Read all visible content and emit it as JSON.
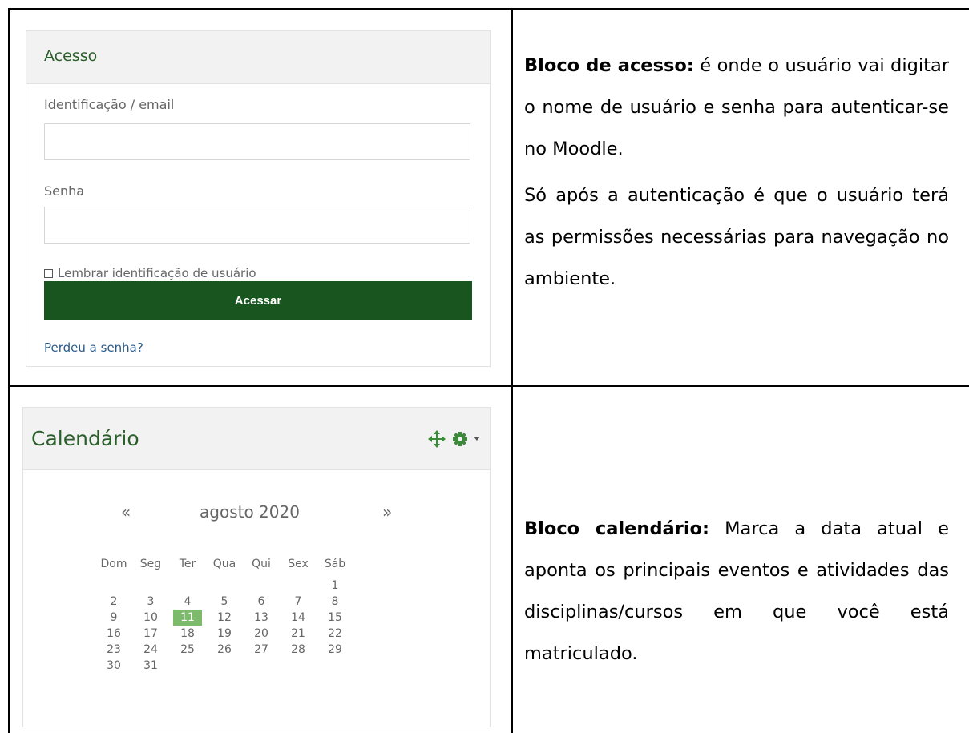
{
  "login": {
    "title": "Acesso",
    "username_label": "Identificação / email",
    "username_value": "",
    "password_label": "Senha",
    "password_value": "",
    "remember_label": "Lembrar identificação de usuário",
    "remember_checked": false,
    "submit_label": "Acessar",
    "forgot_link": "Perdeu a senha?"
  },
  "login_desc": {
    "bold": "Bloco de acesso:",
    "text1": " é onde o usuário vai digitar o nome de usuário e senha para autenticar-se no Moodle.",
    "text2": "Só após a autenticação é que o usuário terá as permissões necessárias para navegação no ambiente."
  },
  "calendar": {
    "title": "Calendário",
    "prev": "«",
    "next": "»",
    "month": "agosto 2020",
    "weekdays": [
      "Dom",
      "Seg",
      "Ter",
      "Qua",
      "Qui",
      "Sex",
      "Sáb"
    ],
    "weeks": [
      [
        "",
        "",
        "",
        "",
        "",
        "",
        "1"
      ],
      [
        "2",
        "3",
        "4",
        "5",
        "6",
        "7",
        "8"
      ],
      [
        "9",
        "10",
        "11",
        "12",
        "13",
        "14",
        "15"
      ],
      [
        "16",
        "17",
        "18",
        "19",
        "20",
        "21",
        "22"
      ],
      [
        "23",
        "24",
        "25",
        "26",
        "27",
        "28",
        "29"
      ],
      [
        "30",
        "31",
        "",
        "",
        "",
        "",
        ""
      ]
    ],
    "today": "11",
    "today_color": "#7cba6c",
    "icons": [
      "move-icon",
      "gear-icon",
      "caret-down-icon"
    ]
  },
  "calendar_desc": {
    "bold": "Bloco calendário:",
    "text1": " Marca a data atual e aponta os principais eventos e atividades das disciplinas/cursos em que você está matriculado."
  },
  "colors": {
    "accent": "#2a5e2a",
    "button": "#18551f",
    "link": "#2a5a8a"
  }
}
